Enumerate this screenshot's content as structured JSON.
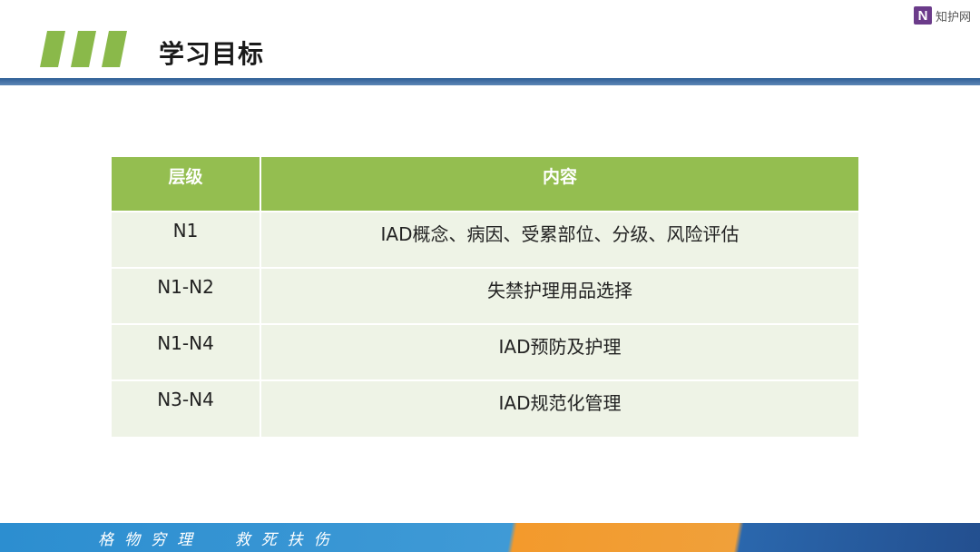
{
  "header": {
    "title": "学习目标",
    "logo_mark": "N",
    "logo_text": "知护网"
  },
  "table": {
    "columns": [
      "层级",
      "内容"
    ],
    "rows": [
      {
        "level": "N1",
        "content": "IAD概念、病因、受累部位、分级、风险评估"
      },
      {
        "level": "N1-N2",
        "content": "失禁护理用品选择"
      },
      {
        "level": "N1-N4",
        "content": "IAD预防及护理"
      },
      {
        "level": "N3-N4",
        "content": "IAD规范化管理"
      }
    ]
  },
  "footer": {
    "motto": "格物穷理  救死扶伤"
  },
  "colors": {
    "accent_green": "#94be50",
    "row_bg": "#eef3e6",
    "header_bar_blue": "#2f5f96",
    "logo_purple": "#6b3b8a"
  },
  "icons": [
    "stripes-decoration-icon"
  ]
}
